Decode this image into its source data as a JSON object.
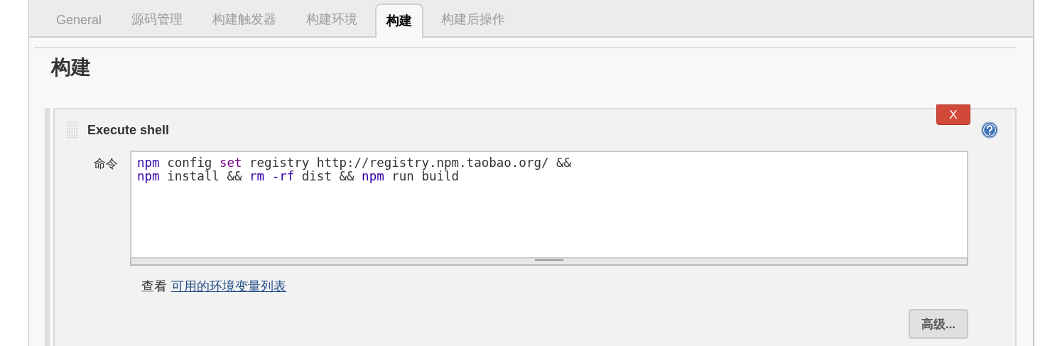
{
  "tabs": [
    {
      "label": "General",
      "selected": false
    },
    {
      "label": "源码管理",
      "selected": false
    },
    {
      "label": "构建触发器",
      "selected": false
    },
    {
      "label": "构建环境",
      "selected": false
    },
    {
      "label": "构建",
      "selected": true
    },
    {
      "label": "构建后操作",
      "selected": false
    }
  ],
  "section": {
    "title": "构建"
  },
  "build_step": {
    "title": "Execute shell",
    "delete_label": "X",
    "field_label": "命令",
    "command_lines": [
      [
        {
          "text": "npm",
          "kind": "command"
        },
        {
          "text": " config ",
          "kind": "plain"
        },
        {
          "text": "set",
          "kind": "keyword"
        },
        {
          "text": " registry http://registry.npm.taobao.org/ &&",
          "kind": "plain"
        }
      ],
      [
        {
          "text": "npm",
          "kind": "command"
        },
        {
          "text": " install && ",
          "kind": "plain"
        },
        {
          "text": "rm ",
          "kind": "command"
        },
        {
          "text": "-rf",
          "kind": "command"
        },
        {
          "text": " dist && ",
          "kind": "plain"
        },
        {
          "text": "npm",
          "kind": "command"
        },
        {
          "text": " run build",
          "kind": "plain"
        }
      ]
    ],
    "hint_prefix": "查看",
    "hint_link": "可用的环境变量列表",
    "advanced_button": "高级..."
  }
}
